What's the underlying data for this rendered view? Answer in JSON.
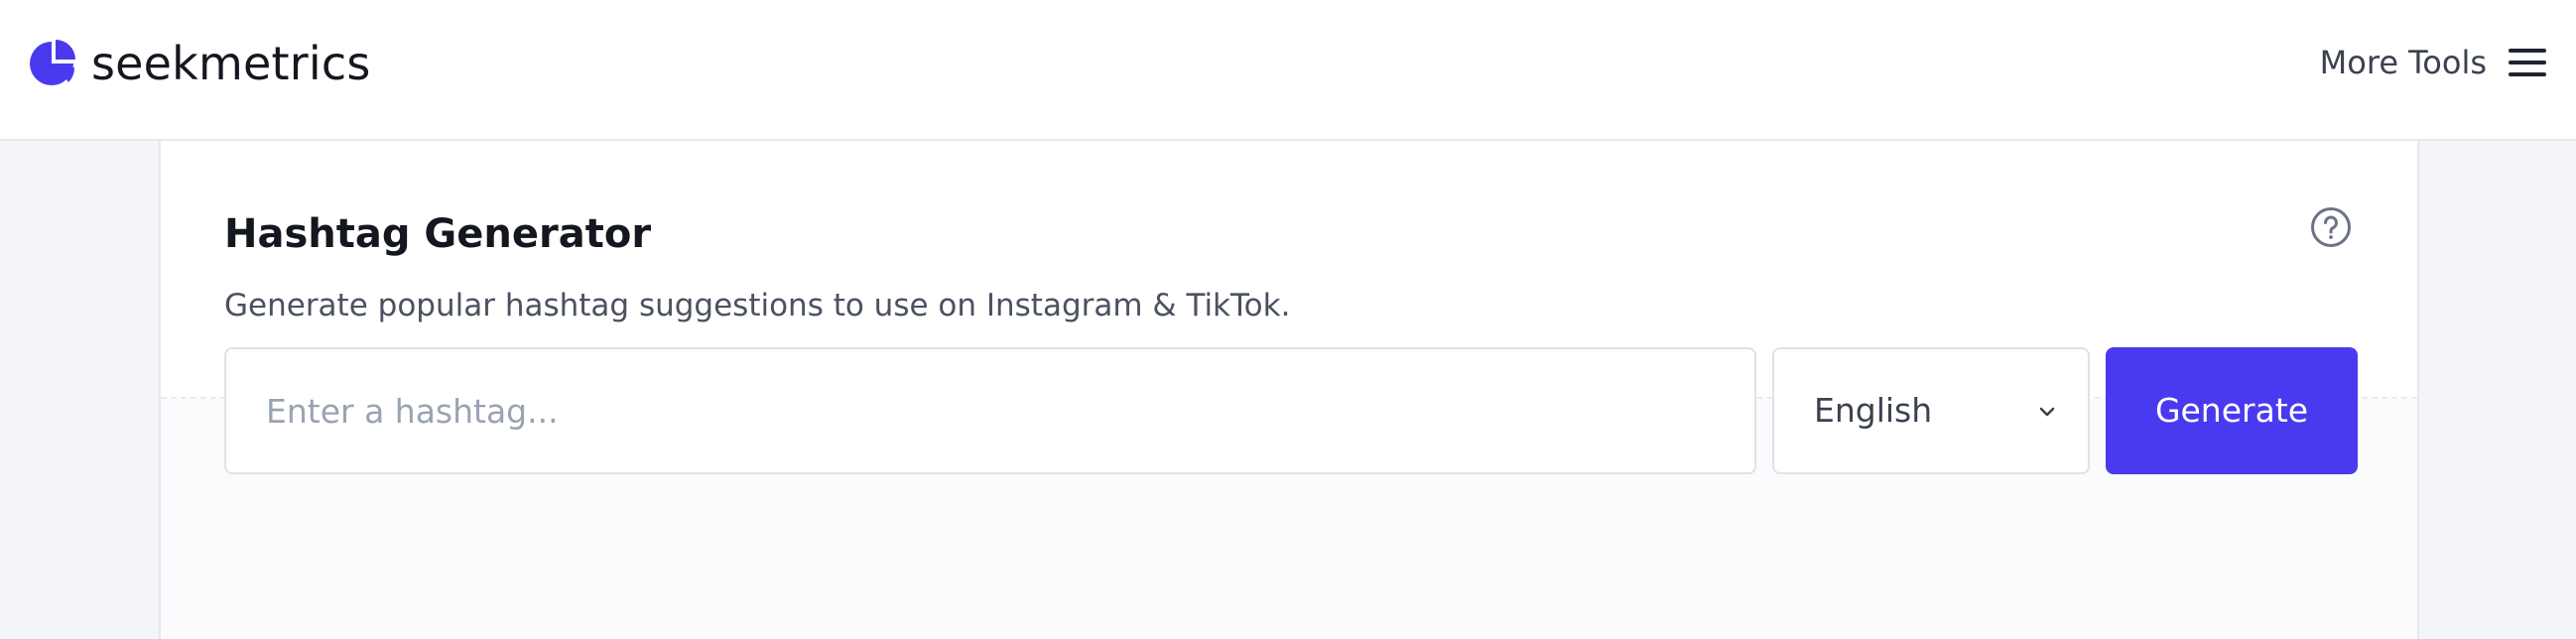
{
  "brand": {
    "name": "seekmetrics",
    "logo_icon": "pie-chart-logo-icon",
    "accent_color": "#4a3aef"
  },
  "nav": {
    "more_tools_label": "More Tools",
    "menu_icon": "hamburger-menu-icon"
  },
  "tool": {
    "title": "Hashtag Generator",
    "subtitle": "Generate popular hashtag suggestions to use on Instagram & TikTok.",
    "help_icon": "question-circle-icon"
  },
  "form": {
    "hashtag_input": {
      "placeholder": "Enter a hashtag...",
      "value": ""
    },
    "language_select": {
      "selected": "English",
      "icon": "chevron-down-icon"
    },
    "generate_button_label": "Generate",
    "button_color": "#4a3aef"
  }
}
